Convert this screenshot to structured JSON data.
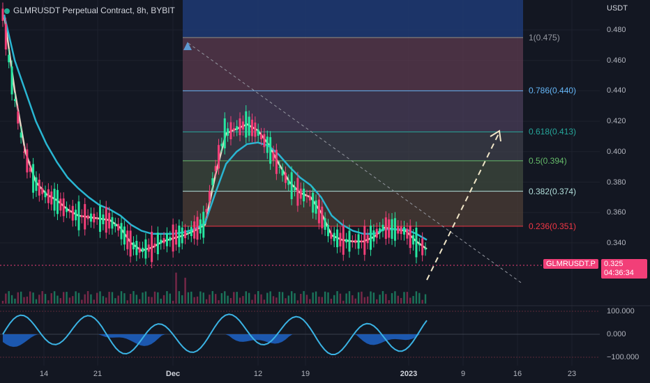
{
  "header": {
    "title": "GLMRUSDT Perpetual Contract, 8h, BYBIT"
  },
  "price_axis": {
    "unit": "USDT",
    "ticks": [
      "0.480",
      "0.460",
      "0.440",
      "0.420",
      "0.400",
      "0.380",
      "0.360",
      "0.340"
    ]
  },
  "osc_axis": {
    "ticks": [
      "100.000",
      "0.000",
      "−100.000"
    ]
  },
  "time_axis": {
    "ticks": [
      "14",
      "21",
      "Dec",
      "12",
      "19",
      "2023",
      "9",
      "16",
      "23"
    ]
  },
  "last_price": {
    "symbol": "GLMRUSDT.P",
    "price": "0.325",
    "countdown": "04:36:34"
  },
  "fib": [
    {
      "label": "1(0.475)",
      "value": 0.475,
      "color": "#9598a1"
    },
    {
      "label": "0.786(0.440)",
      "value": 0.44,
      "color": "#64b5f6"
    },
    {
      "label": "0.618(0.413)",
      "value": 0.413,
      "color": "#26a69a"
    },
    {
      "label": "0.5(0.394)",
      "value": 0.394,
      "color": "#66bb6a"
    },
    {
      "label": "0.382(0.374)",
      "value": 0.374,
      "color": "#b2dfdb"
    },
    {
      "label": "0.236(0.351)",
      "value": 0.351,
      "color": "#f23645"
    }
  ],
  "colors": {
    "bg": "#131722",
    "up": "#26e6a0",
    "down": "#f23f78",
    "fast_ma": "#e8d5c4",
    "slow_ma": "#29b6d2",
    "badge": "#f23f78"
  },
  "chart_data": {
    "type": "line",
    "title": "GLMRUSDT Perpetual Contract, 8h, BYBIT",
    "ylabel": "USDT",
    "ylim": [
      0.325,
      0.49
    ],
    "series": [
      {
        "values": [
          0.49,
          0.44,
          0.4,
          0.38,
          0.372,
          0.368,
          0.362,
          0.358,
          0.357,
          0.356,
          0.355,
          0.35,
          0.34,
          0.335,
          0.337,
          0.341,
          0.343,
          0.345,
          0.348,
          0.352,
          0.385,
          0.412,
          0.415,
          0.418,
          0.414,
          0.405,
          0.392,
          0.38,
          0.373,
          0.37,
          0.36,
          0.345,
          0.342,
          0.341,
          0.341,
          0.344,
          0.35,
          0.349,
          0.348,
          0.341,
          0.336
        ]
      },
      {
        "values": [
          0.49,
          0.46,
          0.44,
          0.42,
          0.405,
          0.393,
          0.383,
          0.376,
          0.37,
          0.365,
          0.362,
          0.358,
          0.352,
          0.348,
          0.346,
          0.346,
          0.346,
          0.347,
          0.349,
          0.353,
          0.373,
          0.392,
          0.4,
          0.405,
          0.406,
          0.404,
          0.398,
          0.39,
          0.383,
          0.378,
          0.37,
          0.358,
          0.352,
          0.348,
          0.346,
          0.346,
          0.349,
          0.349,
          0.349,
          0.346,
          0.342
        ]
      }
    ]
  }
}
